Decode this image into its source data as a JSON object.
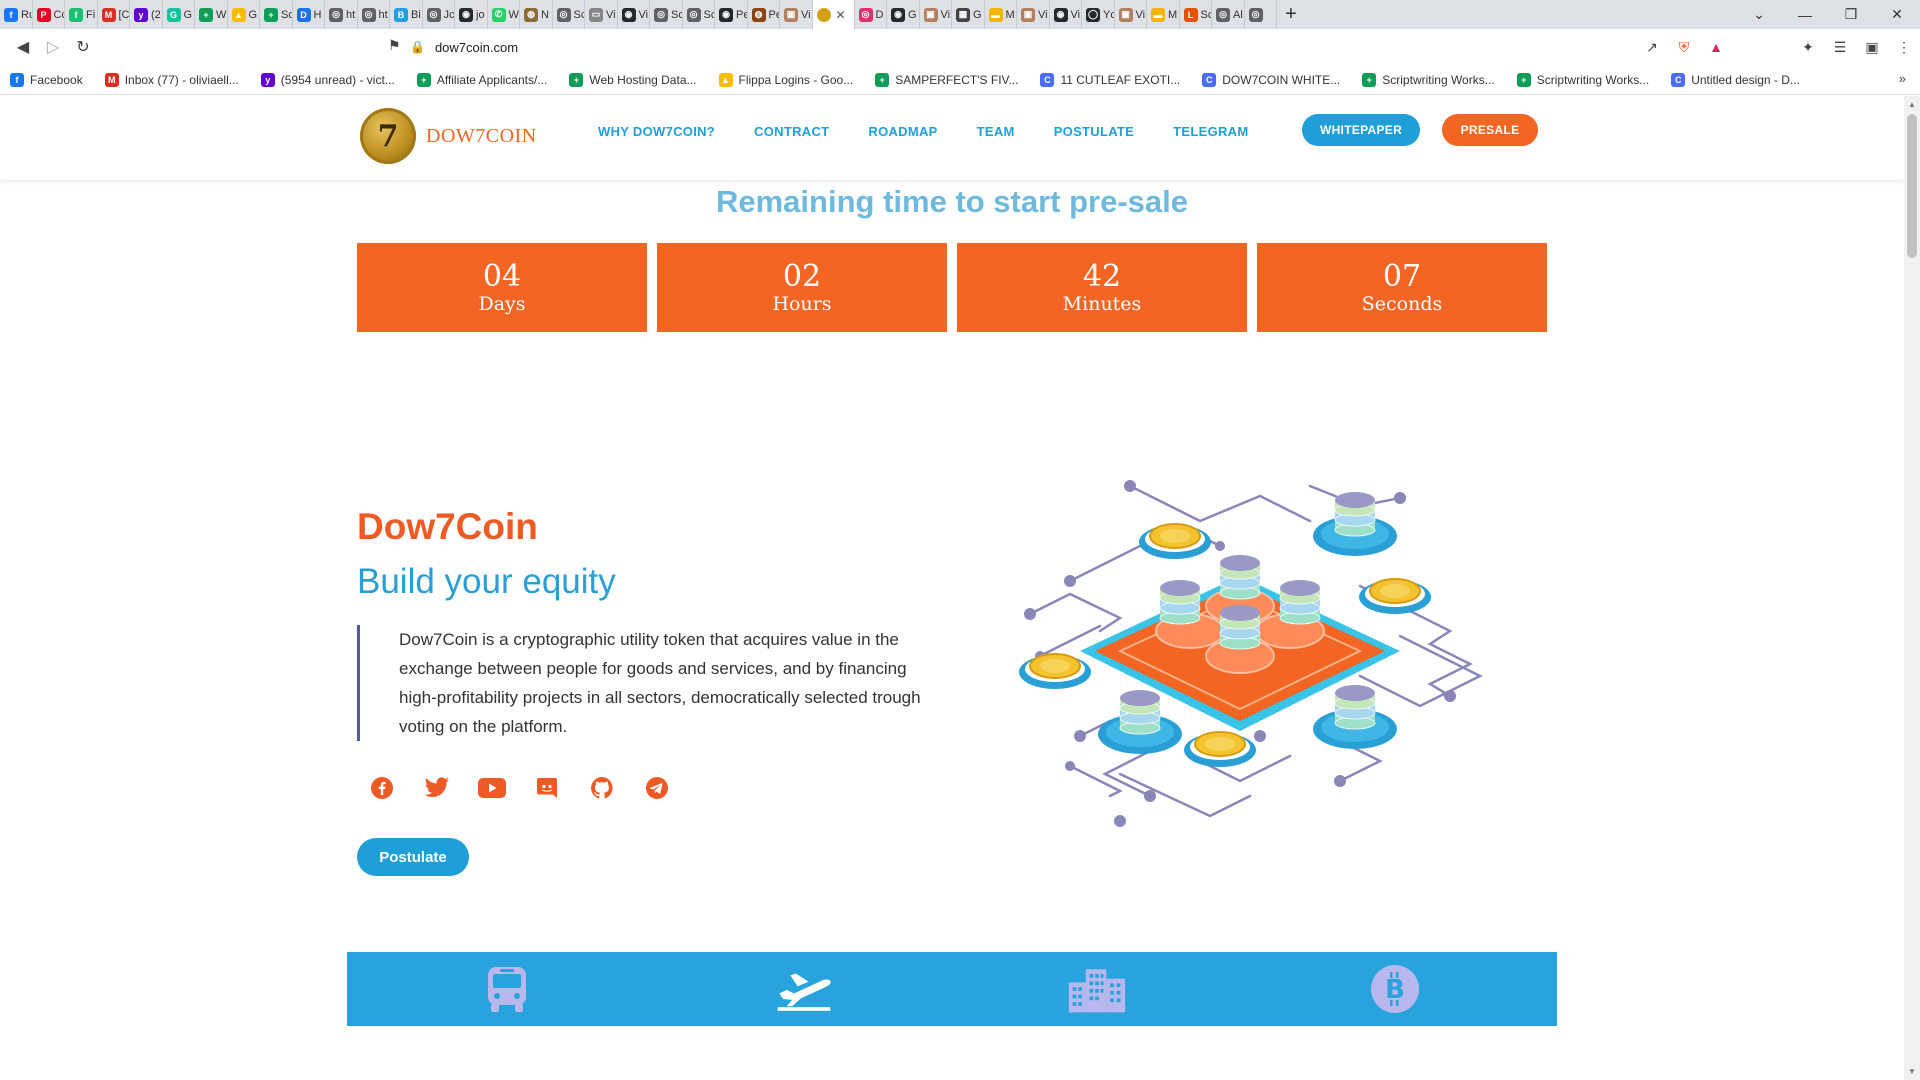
{
  "browser": {
    "tabs": [
      {
        "label": "Ru",
        "color": "#1877f2",
        "glyph": "f"
      },
      {
        "label": "Cc",
        "color": "#e60023",
        "glyph": "P"
      },
      {
        "label": "Fi",
        "color": "#1dbf73",
        "glyph": "f"
      },
      {
        "label": "[C",
        "color": "#d93025",
        "glyph": "M"
      },
      {
        "label": "(2",
        "color": "#6001d2",
        "glyph": "y"
      },
      {
        "label": "G",
        "color": "#15c39a",
        "glyph": "G"
      },
      {
        "label": "W",
        "color": "#0f9d58",
        "glyph": "+"
      },
      {
        "label": "G",
        "color": "#fbbc04",
        "glyph": "▲"
      },
      {
        "label": "Sc",
        "color": "#0f9d58",
        "glyph": "+"
      },
      {
        "label": "H",
        "color": "#1a73e8",
        "glyph": "D"
      },
      {
        "label": "ht",
        "color": "#5f6368",
        "glyph": "◎"
      },
      {
        "label": "ht",
        "color": "#5f6368",
        "glyph": "◎"
      },
      {
        "label": "Bi",
        "color": "#21a0e1",
        "glyph": "B"
      },
      {
        "label": "Jc",
        "color": "#5f6368",
        "glyph": "◎"
      },
      {
        "label": "jo",
        "color": "#24292e",
        "glyph": "◉"
      },
      {
        "label": "W",
        "color": "#25d366",
        "glyph": "✆"
      },
      {
        "label": "N",
        "color": "#8a6d3b",
        "glyph": "◍"
      },
      {
        "label": "Sc",
        "color": "#5f6368",
        "glyph": "◎"
      },
      {
        "label": "Vi",
        "color": "#888888",
        "glyph": "▭"
      },
      {
        "label": "Vi",
        "color": "#24292e",
        "glyph": "◉"
      },
      {
        "label": "Sc",
        "color": "#5f6368",
        "glyph": "◎"
      },
      {
        "label": "Sc",
        "color": "#5f6368",
        "glyph": "◎"
      },
      {
        "label": "Pe",
        "color": "#24292e",
        "glyph": "◉"
      },
      {
        "label": "Pe",
        "color": "#8b4513",
        "glyph": "◍"
      },
      {
        "label": "Vi",
        "color": "#b08060",
        "glyph": "▣"
      }
    ],
    "active_tab": {
      "color": "#d4a017"
    },
    "tabs_after": [
      {
        "label": "D",
        "color": "#e1306c",
        "glyph": "◎"
      },
      {
        "label": "G",
        "color": "#24292e",
        "glyph": "◉"
      },
      {
        "label": "Vi",
        "color": "#b08060",
        "glyph": "▣"
      },
      {
        "label": "G",
        "color": "#444444",
        "glyph": "▦"
      },
      {
        "label": "M",
        "color": "#f4b400",
        "glyph": "▬"
      },
      {
        "label": "Vi",
        "color": "#b08060",
        "glyph": "▣"
      },
      {
        "label": "Vi",
        "color": "#24292e",
        "glyph": "◉"
      },
      {
        "label": "Yc",
        "color": "#24292e",
        "glyph": "◯"
      },
      {
        "label": "Vi",
        "color": "#b08060",
        "glyph": "▣"
      },
      {
        "label": "M",
        "color": "#f4b400",
        "glyph": "▬"
      },
      {
        "label": "Sc",
        "color": "#e65100",
        "glyph": "L"
      },
      {
        "label": "Al",
        "color": "#5f6368",
        "glyph": "◎"
      },
      {
        "label": "",
        "color": "#5f6368",
        "glyph": "◎"
      }
    ],
    "url": "dow7coin.com",
    "bookmarks": [
      {
        "label": "Facebook",
        "color": "#1877f2",
        "glyph": "f"
      },
      {
        "label": "Inbox (77) - oliviaell...",
        "color": "#d93025",
        "glyph": "M"
      },
      {
        "label": "(5954 unread) - vict...",
        "color": "#6001d2",
        "glyph": "y"
      },
      {
        "label": "Affiliate Applicants/...",
        "color": "#0f9d58",
        "glyph": "+"
      },
      {
        "label": "Web Hosting Data...",
        "color": "#0f9d58",
        "glyph": "+"
      },
      {
        "label": "Flippa Logins - Goo...",
        "color": "#fbbc04",
        "glyph": "▲"
      },
      {
        "label": "SAMPERFECT'S FIV...",
        "color": "#0f9d58",
        "glyph": "+"
      },
      {
        "label": "11 CUTLEAF EXOTI...",
        "color": "#4a6cf7",
        "glyph": "C"
      },
      {
        "label": "DOW7COIN WHITE...",
        "color": "#4a6cf7",
        "glyph": "C"
      },
      {
        "label": "Scriptwriting Works...",
        "color": "#0f9d58",
        "glyph": "+"
      },
      {
        "label": "Scriptwriting Works...",
        "color": "#0f9d58",
        "glyph": "+"
      },
      {
        "label": "Untitled design - D...",
        "color": "#4a6cf7",
        "glyph": "C"
      }
    ]
  },
  "site": {
    "logo_text": "DOW7COIN",
    "logo_glyph": "7",
    "nav": [
      "WHY DOW7COIN?",
      "CONTRACT",
      "ROADMAP",
      "TEAM",
      "POSTULATE",
      "TELEGRAM"
    ],
    "whitepaper_label": "WHITEPAPER",
    "presale_label": "PRESALE",
    "countdown_title": "Remaining time to start pre-sale",
    "countdown": [
      {
        "value": "04",
        "unit": "Days"
      },
      {
        "value": "02",
        "unit": "Hours"
      },
      {
        "value": "42",
        "unit": "Minutes"
      },
      {
        "value": "07",
        "unit": "Seconds"
      }
    ],
    "hero_title": "Dow7Coin",
    "hero_subtitle": "Build your equity",
    "hero_text": "Dow7Coin is a cryptographic utility token that acquires value in the exchange between people for goods and services, and by financing high-profitability projects in all sectors, democratically selected trough voting on the platform.",
    "socials": [
      "facebook-icon",
      "twitter-icon",
      "youtube-icon",
      "discord-icon",
      "github-icon",
      "telegram-icon"
    ],
    "postulate_label": "Postulate",
    "features": [
      "bus-icon",
      "airplane-icon",
      "buildings-icon",
      "bitcoin-icon"
    ],
    "colors": {
      "accent_orange": "#f26522",
      "accent_blue": "#1e9fd8",
      "band_blue": "#29a3de"
    }
  }
}
